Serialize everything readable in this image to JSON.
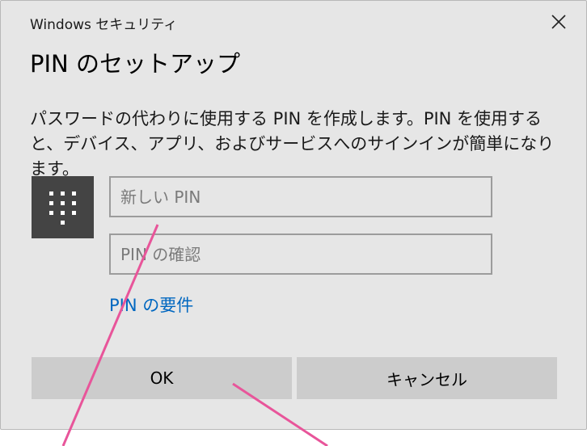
{
  "window": {
    "app_title": "Windows セキュリティ",
    "close_icon": "close-icon"
  },
  "dialog": {
    "heading": "PIN のセットアップ",
    "description": "パスワードの代わりに使用する PIN を作成します。PIN を使用すると、デバイス、アプリ、およびサービスへのサインインが簡単になります。",
    "pin_icon": "keypad-icon",
    "new_pin_placeholder": "新しい PIN",
    "new_pin_value": "",
    "confirm_pin_placeholder": "PIN の確認",
    "confirm_pin_value": "",
    "requirements_link": "PIN の要件",
    "ok_label": "OK",
    "cancel_label": "キャンセル"
  },
  "colors": {
    "background": "#e6e6e6",
    "tile": "#444444",
    "link": "#0067c0",
    "button": "#cccccc",
    "annotation_line": "#e8559a"
  }
}
